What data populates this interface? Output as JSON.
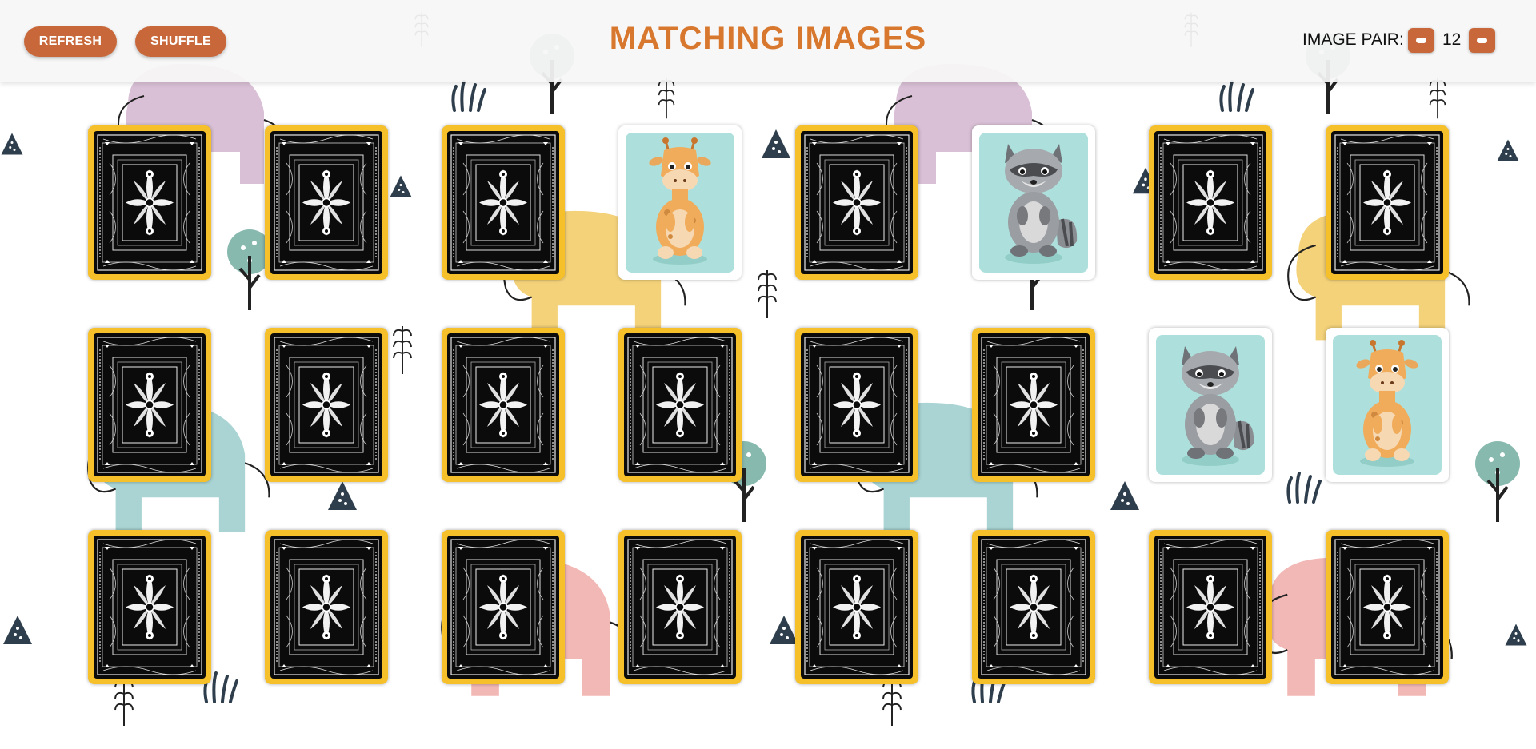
{
  "header": {
    "refresh_label": "REFRESH",
    "shuffle_label": "SHUFFLE",
    "title": "MATCHING IMAGES",
    "pair_label": "IMAGE PAIR:",
    "pair_count": "12"
  },
  "colors": {
    "accent": "#c8683a",
    "title": "#d8782f",
    "card_border": "#f5c02a",
    "card_back": "#0b0b0b",
    "card_front_bg": "#ade0dc"
  },
  "cards": [
    {
      "state": "face-down",
      "image": "card-back-pattern"
    },
    {
      "state": "face-down",
      "image": "card-back-pattern"
    },
    {
      "state": "face-down",
      "image": "card-back-pattern"
    },
    {
      "state": "face-up",
      "image": "giraffe"
    },
    {
      "state": "face-down",
      "image": "card-back-pattern"
    },
    {
      "state": "face-up",
      "image": "raccoon"
    },
    {
      "state": "face-down",
      "image": "card-back-pattern"
    },
    {
      "state": "face-down",
      "image": "card-back-pattern"
    },
    {
      "state": "face-down",
      "image": "card-back-pattern"
    },
    {
      "state": "face-down",
      "image": "card-back-pattern"
    },
    {
      "state": "face-down",
      "image": "card-back-pattern"
    },
    {
      "state": "face-down",
      "image": "card-back-pattern"
    },
    {
      "state": "face-down",
      "image": "card-back-pattern"
    },
    {
      "state": "face-down",
      "image": "card-back-pattern"
    },
    {
      "state": "face-up",
      "image": "raccoon"
    },
    {
      "state": "face-up",
      "image": "giraffe"
    },
    {
      "state": "face-down",
      "image": "card-back-pattern"
    },
    {
      "state": "face-down",
      "image": "card-back-pattern"
    },
    {
      "state": "face-down",
      "image": "card-back-pattern"
    },
    {
      "state": "face-down",
      "image": "card-back-pattern"
    },
    {
      "state": "face-down",
      "image": "card-back-pattern"
    },
    {
      "state": "face-down",
      "image": "card-back-pattern"
    },
    {
      "state": "face-down",
      "image": "card-back-pattern"
    },
    {
      "state": "face-down",
      "image": "card-back-pattern"
    }
  ]
}
